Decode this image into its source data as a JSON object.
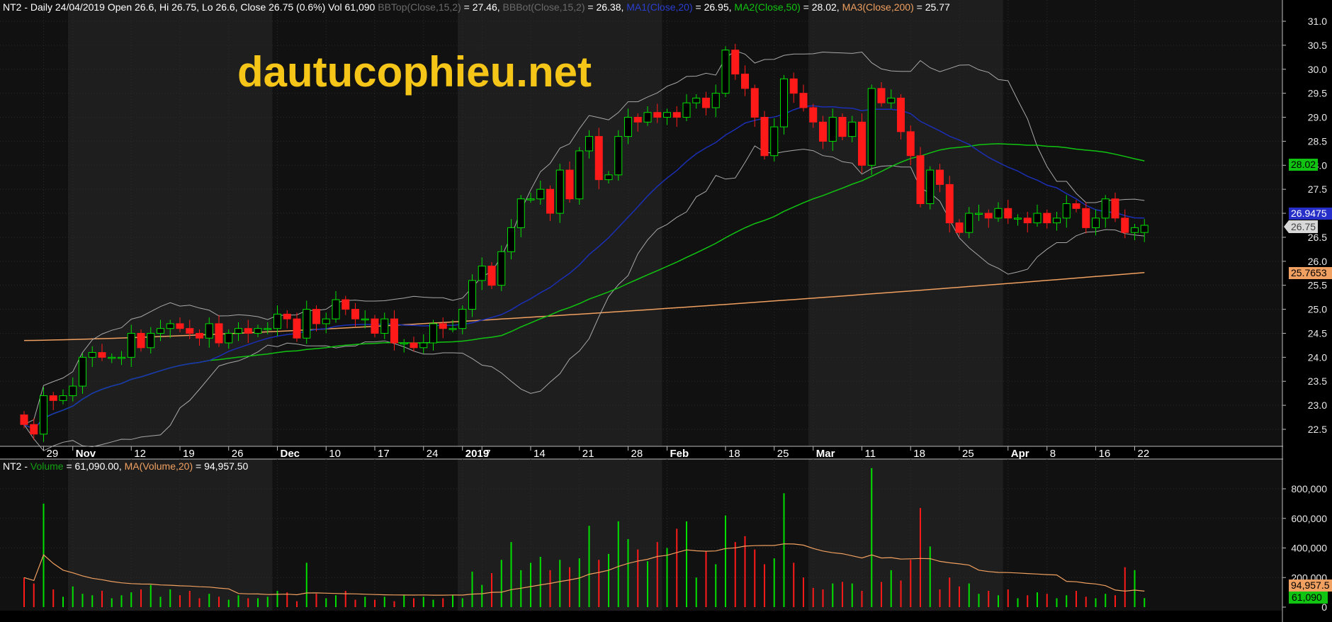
{
  "colors": {
    "background": "#000000",
    "panel_dark": "#111111",
    "panel_light": "#1e1e1e",
    "up": "#00e000",
    "down": "#ff1a1a",
    "bb": "#a8a8a8",
    "ma20": "#1a2fb5",
    "ma50": "#11c411",
    "ma200": "#f0a060",
    "vol_ma": "#f0a060",
    "watermark": "#f5c518"
  },
  "header": {
    "price_info": {
      "lead": "NT2 - Daily 24/04/2019 Open 26.6, Hi 26.75, Lo 26.6, Close 26.75 (0.6%) Vol 61,090 ",
      "bbtop_label": "BBTop(Close,15,2)",
      "bbtop_value": " = 27.46, ",
      "bbbot_label": "BBBot(Close,15,2)",
      "bbbot_value": " = 26.38, ",
      "ma1_label": "MA1(Close,20)",
      "ma1_value": " = 26.95, ",
      "ma2_label": "MA2(Close,50)",
      "ma2_value": " = 28.02, ",
      "ma3_label": "MA3(Close,200)",
      "ma3_value": " = 25.77"
    },
    "volume_info": {
      "lead": "NT2 - ",
      "vol_label": "Volume",
      "vol_value": " = 61,090.00, ",
      "ma_label": "MA(Volume,20)",
      "ma_value": " = 94,957.50"
    }
  },
  "watermark": "dautucophieu.net",
  "tags": {
    "ma2": "28.02",
    "ma1": "26.9475",
    "close": "26.75",
    "ma3": "25.7653",
    "vol_ma": "94,957.5",
    "vol": "61,090"
  },
  "chart_data": [
    {
      "type": "candlestick",
      "symbol": "NT2",
      "period": "Daily",
      "y_ticks": [
        "22.5",
        "23.0",
        "23.5",
        "24.0",
        "24.5",
        "25.0",
        "25.5",
        "26.0",
        "26.5",
        "27.0",
        "27.5",
        "28.0",
        "28.5",
        "29.0",
        "29.5",
        "30.0",
        "30.5",
        "31.0"
      ],
      "ylim": [
        22.0,
        31.3
      ],
      "x_labels": [
        {
          "label": "29",
          "i": 2,
          "major": false
        },
        {
          "label": "Nov",
          "i": 5,
          "major": true
        },
        {
          "label": "12",
          "i": 11,
          "major": false
        },
        {
          "label": "19",
          "i": 16,
          "major": false
        },
        {
          "label": "26",
          "i": 21,
          "major": false
        },
        {
          "label": "Dec",
          "i": 26,
          "major": true
        },
        {
          "label": "10",
          "i": 31,
          "major": false
        },
        {
          "label": "17",
          "i": 36,
          "major": false
        },
        {
          "label": "24",
          "i": 41,
          "major": false
        },
        {
          "label": "2019",
          "i": 45,
          "major": true
        },
        {
          "label": "7",
          "i": 47,
          "major": false
        },
        {
          "label": "14",
          "i": 52,
          "major": false
        },
        {
          "label": "21",
          "i": 57,
          "major": false
        },
        {
          "label": "28",
          "i": 62,
          "major": false
        },
        {
          "label": "Feb",
          "i": 66,
          "major": true
        },
        {
          "label": "18",
          "i": 72,
          "major": false
        },
        {
          "label": "25",
          "i": 77,
          "major": false
        },
        {
          "label": "Mar",
          "i": 81,
          "major": true
        },
        {
          "label": "11",
          "i": 86,
          "major": false
        },
        {
          "label": "18",
          "i": 91,
          "major": false
        },
        {
          "label": "25",
          "i": 96,
          "major": false
        },
        {
          "label": "Apr",
          "i": 101,
          "major": true
        },
        {
          "label": "8",
          "i": 105,
          "major": false
        },
        {
          "label": "16",
          "i": 110,
          "major": false
        },
        {
          "label": "22",
          "i": 114,
          "major": false
        }
      ],
      "closes": [
        22.6,
        22.4,
        23.2,
        23.1,
        23.2,
        23.4,
        24.0,
        24.1,
        24.0,
        24.0,
        24.0,
        24.5,
        24.2,
        24.5,
        24.6,
        24.7,
        24.6,
        24.5,
        24.4,
        24.7,
        24.3,
        24.5,
        24.6,
        24.5,
        24.6,
        24.6,
        24.9,
        24.8,
        24.4,
        25.0,
        24.7,
        24.8,
        25.2,
        25.0,
        24.8,
        24.8,
        24.5,
        24.8,
        24.3,
        24.3,
        24.2,
        24.3,
        24.7,
        24.6,
        24.6,
        25.0,
        25.6,
        25.9,
        25.5,
        26.2,
        26.7,
        27.3,
        27.3,
        27.5,
        27.0,
        27.9,
        27.3,
        28.3,
        28.6,
        27.7,
        27.8,
        28.6,
        29.0,
        28.9,
        29.1,
        29.0,
        29.1,
        29.0,
        29.3,
        29.4,
        29.2,
        29.5,
        30.4,
        29.9,
        29.6,
        29.0,
        28.2,
        28.8,
        29.8,
        29.5,
        29.2,
        28.9,
        28.5,
        29.0,
        28.6,
        28.9,
        28.0,
        29.6,
        29.3,
        29.4,
        28.7,
        28.2,
        27.2,
        27.9,
        27.6,
        26.8,
        26.6,
        27.0,
        27.0,
        26.9,
        27.1,
        26.9,
        26.9,
        26.8,
        27.0,
        26.8,
        26.9,
        27.2,
        27.1,
        26.7,
        26.9,
        27.3,
        26.9,
        26.6,
        26.7,
        26.75
      ],
      "volumes": [
        200000,
        160000,
        700000,
        120000,
        70000,
        140000,
        90000,
        80000,
        110000,
        60000,
        80000,
        100000,
        120000,
        150000,
        70000,
        120000,
        80000,
        110000,
        60000,
        90000,
        70000,
        50000,
        80000,
        60000,
        60000,
        70000,
        110000,
        100000,
        40000,
        300000,
        90000,
        60000,
        80000,
        110000,
        50000,
        70000,
        50000,
        70000,
        40000,
        80000,
        60000,
        70000,
        50000,
        60000,
        80000,
        60000,
        240000,
        150000,
        230000,
        320000,
        440000,
        250000,
        300000,
        340000,
        250000,
        320000,
        270000,
        330000,
        550000,
        320000,
        360000,
        580000,
        460000,
        390000,
        310000,
        440000,
        400000,
        530000,
        580000,
        200000,
        380000,
        290000,
        620000,
        440000,
        480000,
        390000,
        290000,
        330000,
        770000,
        300000,
        200000,
        130000,
        120000,
        160000,
        170000,
        160000,
        110000,
        940000,
        170000,
        250000,
        180000,
        320000,
        670000,
        410000,
        120000,
        200000,
        140000,
        160000,
        90000,
        110000,
        80000,
        120000,
        60000,
        80000,
        100000,
        90000,
        60000,
        80000,
        110000,
        70000,
        60000,
        90000,
        80000,
        270000,
        250000,
        61090
      ],
      "ma200_start": 24.35,
      "ma200_end": 25.7653,
      "vol_ticks": [
        "0",
        "200,000",
        "400,000",
        "600,000",
        "800,000"
      ],
      "vol_ylim": [
        0,
        960000
      ]
    }
  ]
}
